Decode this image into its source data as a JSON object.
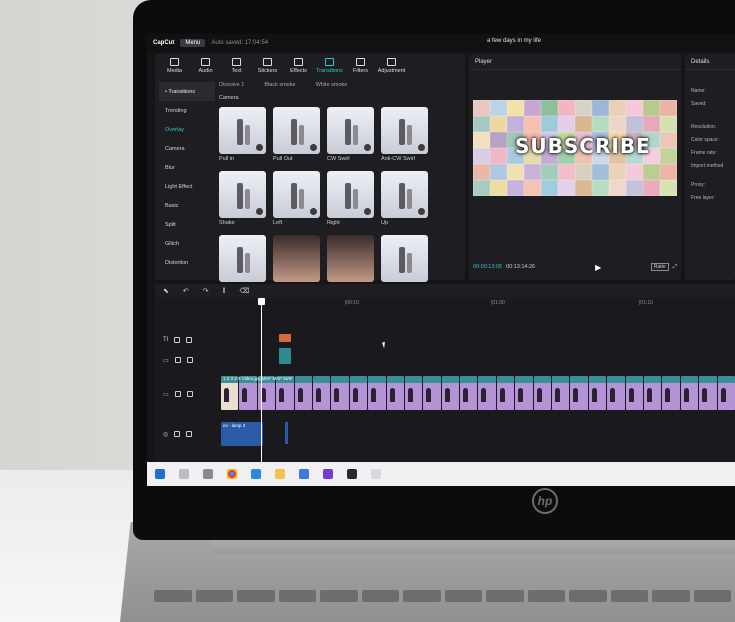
{
  "app": {
    "name": "CapCut",
    "menu_label": "Menu",
    "autosave": "Auto saved: 17:04:54",
    "project_title": "a few days in my life"
  },
  "toolbar": {
    "items": [
      {
        "label": "Media",
        "icon": "media-icon"
      },
      {
        "label": "Audio",
        "icon": "audio-icon"
      },
      {
        "label": "Text",
        "icon": "text-icon"
      },
      {
        "label": "Stickers",
        "icon": "sticker-icon"
      },
      {
        "label": "Effects",
        "icon": "effects-icon"
      },
      {
        "label": "Transitions",
        "icon": "transitions-icon"
      },
      {
        "label": "Filters",
        "icon": "filters-icon"
      },
      {
        "label": "Adjustment",
        "icon": "adjustment-icon"
      }
    ],
    "active": "Transitions"
  },
  "sidebar": {
    "items": [
      {
        "label": "• Transitions"
      },
      {
        "label": "Trending"
      },
      {
        "label": "Overlay"
      },
      {
        "label": "Camera"
      },
      {
        "label": "Blur"
      },
      {
        "label": "Light Effect"
      },
      {
        "label": "Basic"
      },
      {
        "label": "Split"
      },
      {
        "label": "Glitch"
      },
      {
        "label": "Distortion"
      }
    ]
  },
  "content": {
    "tabs": [
      "Dissolve 1",
      "Black smoke",
      "White smoke"
    ],
    "section": "Camera",
    "tiles": [
      {
        "label": "Pull in"
      },
      {
        "label": "Pull Out"
      },
      {
        "label": "CW Swirl"
      },
      {
        "label": "Anti-CW Swirl"
      },
      {
        "label": "Shake"
      },
      {
        "label": "Left"
      },
      {
        "label": "Right"
      },
      {
        "label": "Up"
      },
      {
        "label": ""
      },
      {
        "label": ""
      },
      {
        "label": ""
      },
      {
        "label": ""
      }
    ]
  },
  "player": {
    "title": "Player",
    "overlay_text": "SUBSCRIBE",
    "current_time": "00:00:13:05",
    "total_time": "00:13:14:26",
    "ratio_label": "Ratio"
  },
  "details": {
    "title": "Details",
    "rows": [
      "Name:",
      "Saved:",
      "Resolution:",
      "Color space:",
      "Frame rate:",
      "Import method",
      "Proxy:",
      "Free layer:"
    ]
  },
  "timeline": {
    "ruler": [
      "|00:10",
      "|01:00",
      "|01:10"
    ],
    "main_track_label": "1 2 3 4 5 Video.jpg MAF MAF MAF",
    "audio_label": "ex - lamp 3"
  },
  "brand_logo": "hp"
}
